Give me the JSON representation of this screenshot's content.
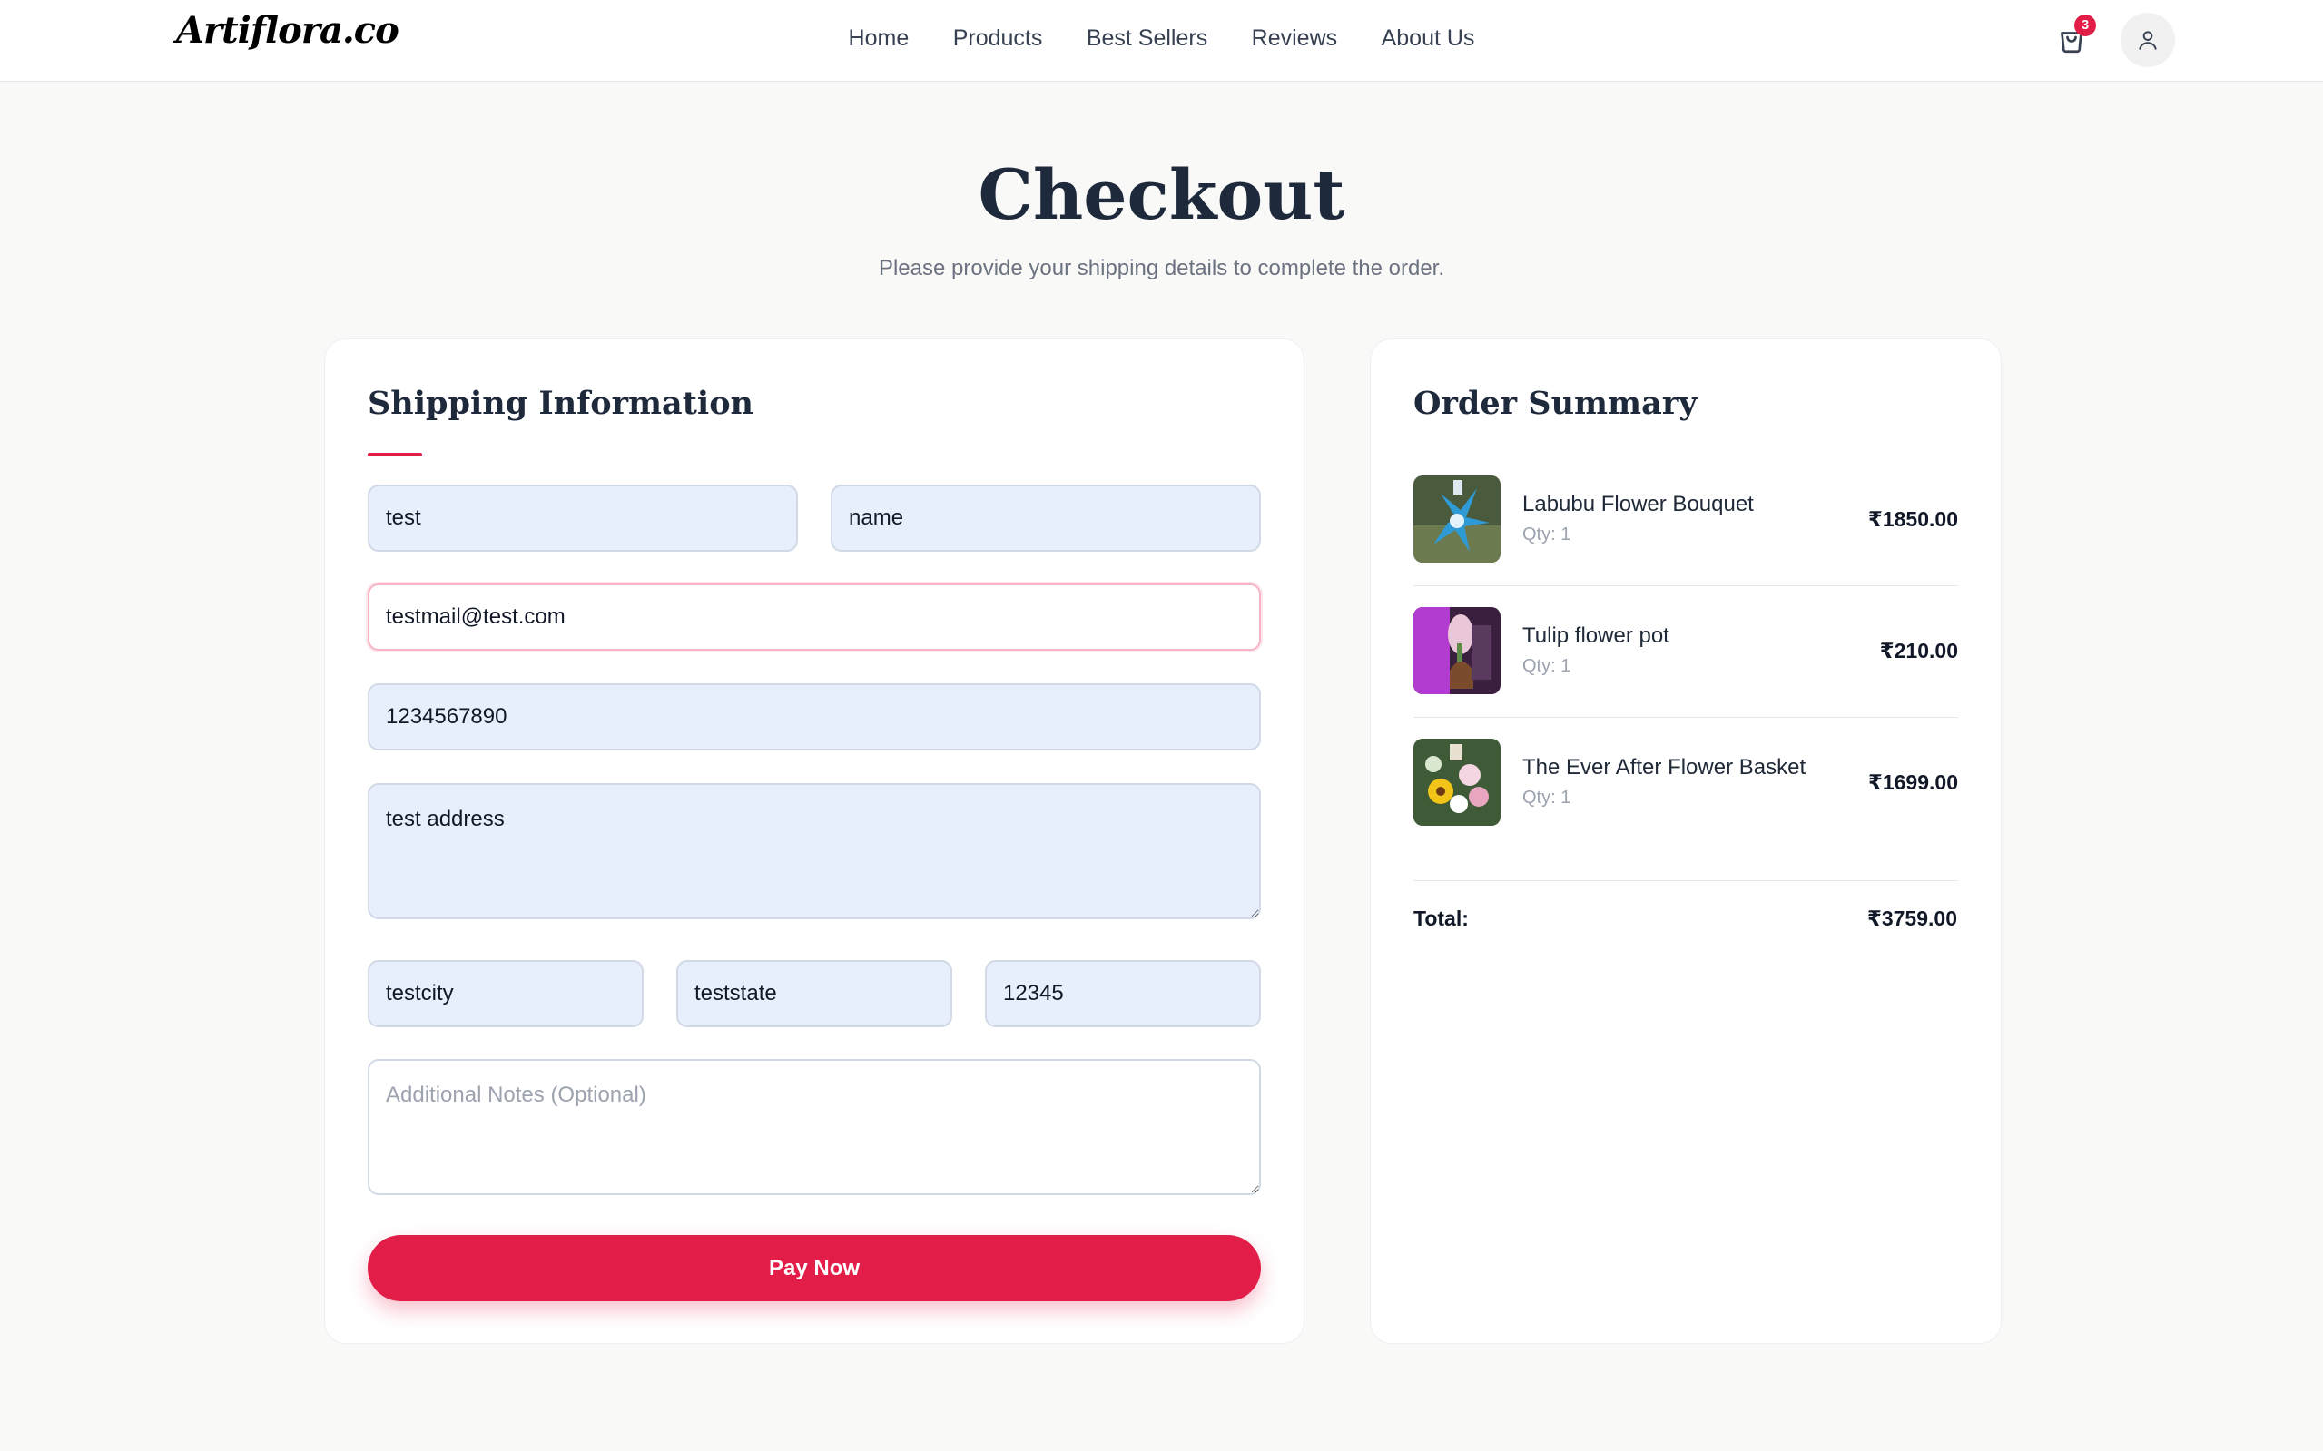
{
  "brand": {
    "logo": "Artiflora.co"
  },
  "nav": {
    "items": [
      "Home",
      "Products",
      "Best Sellers",
      "Reviews",
      "About Us"
    ],
    "cart_count": "3",
    "cart_icon": "cart-icon",
    "user_icon": "user-icon"
  },
  "page": {
    "title": "Checkout",
    "subtitle": "Please provide your shipping details to complete the order."
  },
  "shipping": {
    "heading": "Shipping Information",
    "first_name": "test",
    "last_name": "name",
    "email": "testmail@test.com",
    "phone": "1234567890",
    "address": "test address",
    "city": "testcity",
    "state": "teststate",
    "zip": "12345",
    "notes_placeholder": "Additional Notes (Optional)",
    "pay_label": "Pay Now"
  },
  "summary": {
    "heading": "Order Summary",
    "items": [
      {
        "name": "Labubu Flower Bouquet",
        "qty": "Qty: 1",
        "price": "₹1850.00"
      },
      {
        "name": "Tulip flower pot",
        "qty": "Qty: 1",
        "price": "₹210.00"
      },
      {
        "name": "The Ever After Flower Basket",
        "qty": "Qty: 1",
        "price": "₹1699.00"
      }
    ],
    "total_label": "Total:",
    "total_value": "₹3759.00"
  },
  "colors": {
    "accent": "#e11d48",
    "input_bg": "#e8effc",
    "page_bg": "#f9f9f8"
  }
}
